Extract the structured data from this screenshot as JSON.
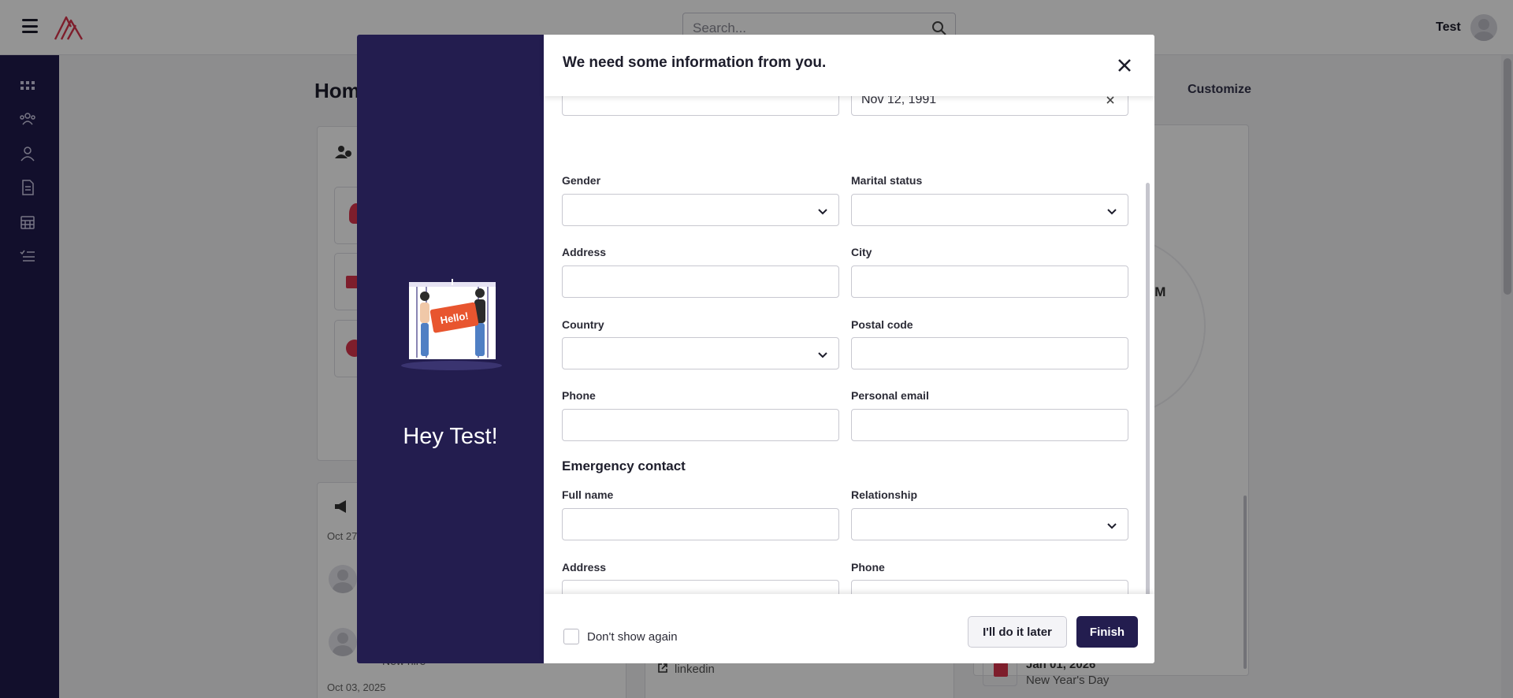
{
  "app": {
    "user_name": "Test",
    "search_placeholder": "Search...",
    "page_title": "Home",
    "customize_label": "Customize",
    "brand_accent": "#231d4f"
  },
  "sidebar": {
    "icons": [
      "dashboard-icon",
      "team-icon",
      "person-icon",
      "document-icon",
      "calendar-icon",
      "checklist-icon"
    ]
  },
  "background": {
    "date_1": "Oct 27",
    "date_2": "Oct 03, 2025",
    "new_hire_text": "New hire",
    "link_text": "linkedin",
    "holiday_date": "Jan 01, 2026",
    "holiday_name": "New Year's Day",
    "time_text": "OM"
  },
  "modal": {
    "title": "We need some information from you.",
    "greeting": "Hey Test!",
    "illustration_text": "Hello!",
    "fields": {
      "birthdate_value": "Nov 12, 1991",
      "gender_label": "Gender",
      "marital_label": "Marital status",
      "address_label": "Address",
      "city_label": "City",
      "country_label": "Country",
      "postal_label": "Postal code",
      "phone_label": "Phone",
      "email_label": "Personal email"
    },
    "emergency": {
      "heading": "Emergency contact",
      "fullname_label": "Full name",
      "relationship_label": "Relationship",
      "address_label": "Address",
      "phone_label": "Phone"
    },
    "footer": {
      "dont_show_label": "Don't show again",
      "later_label": "I'll do it later",
      "finish_label": "Finish"
    }
  }
}
